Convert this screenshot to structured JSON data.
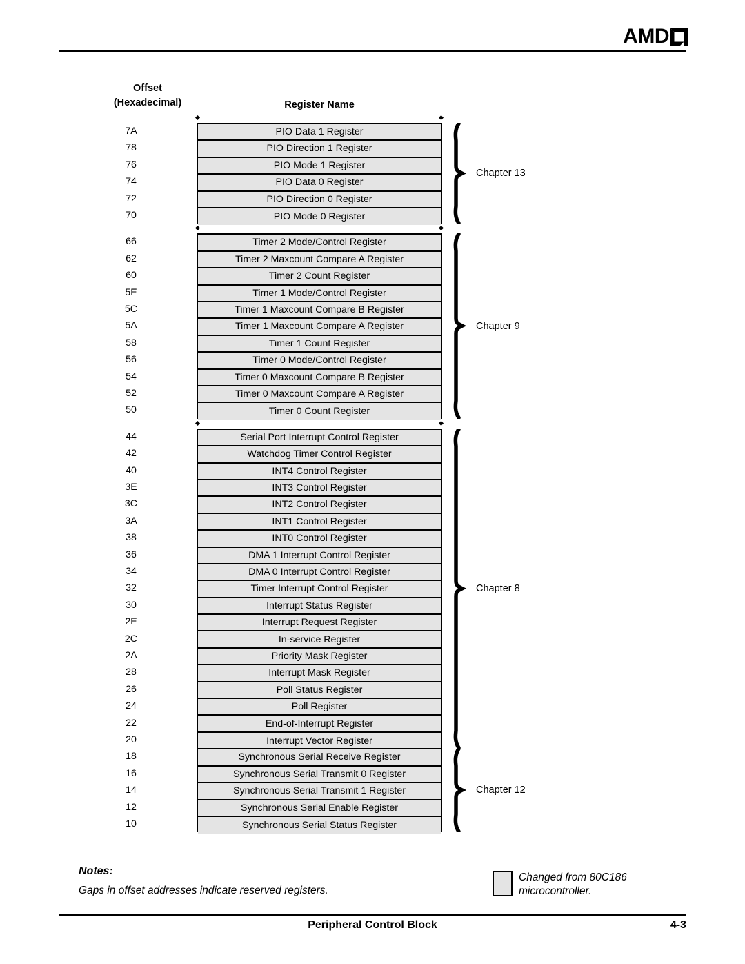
{
  "header": {
    "logo_text": "AMD",
    "logo_mark": "amd-arrow-icon"
  },
  "column_headings": {
    "offset": "Offset\n(Hexadecimal)",
    "offset_line1": "Offset",
    "offset_line2": "(Hexadecimal)",
    "register_name": "Register Name"
  },
  "groups": [
    {
      "chapter": "Chapter 13",
      "rows": [
        {
          "offset": "7A",
          "name": "PIO Data 1 Register"
        },
        {
          "offset": "78",
          "name": "PIO Direction 1 Register"
        },
        {
          "offset": "76",
          "name": "PIO Mode 1 Register"
        },
        {
          "offset": "74",
          "name": "PIO Data 0 Register"
        },
        {
          "offset": "72",
          "name": "PIO Direction 0 Register"
        },
        {
          "offset": "70",
          "name": "PIO Mode 0 Register"
        }
      ]
    },
    {
      "chapter": "Chapter 9",
      "rows": [
        {
          "offset": "66",
          "name": "Timer 2 Mode/Control Register"
        },
        {
          "offset": "62",
          "name": "Timer 2 Maxcount Compare A Register"
        },
        {
          "offset": "60",
          "name": "Timer 2 Count Register"
        },
        {
          "offset": "5E",
          "name": "Timer 1 Mode/Control Register"
        },
        {
          "offset": "5C",
          "name": "Timer 1 Maxcount Compare B Register"
        },
        {
          "offset": "5A",
          "name": "Timer 1 Maxcount Compare A Register"
        },
        {
          "offset": "58",
          "name": "Timer 1 Count Register"
        },
        {
          "offset": "56",
          "name": "Timer 0 Mode/Control Register"
        },
        {
          "offset": "54",
          "name": "Timer 0 Maxcount Compare B Register"
        },
        {
          "offset": "52",
          "name": "Timer 0 Maxcount Compare A Register"
        },
        {
          "offset": "50",
          "name": "Timer 0 Count Register"
        }
      ]
    },
    {
      "chapter": "Chapter 8",
      "rows": [
        {
          "offset": "44",
          "name": "Serial Port Interrupt Control Register"
        },
        {
          "offset": "42",
          "name": "Watchdog Timer Control Register"
        },
        {
          "offset": "40",
          "name": "INT4 Control Register"
        },
        {
          "offset": "3E",
          "name": "INT3 Control Register"
        },
        {
          "offset": "3C",
          "name": "INT2 Control Register"
        },
        {
          "offset": "3A",
          "name": "INT1 Control Register"
        },
        {
          "offset": "38",
          "name": "INT0 Control Register"
        },
        {
          "offset": "36",
          "name": "DMA 1 Interrupt Control Register"
        },
        {
          "offset": "34",
          "name": "DMA 0 Interrupt Control Register"
        },
        {
          "offset": "32",
          "name": "Timer Interrupt Control Register"
        },
        {
          "offset": "30",
          "name": "Interrupt Status Register"
        },
        {
          "offset": "2E",
          "name": "Interrupt Request Register"
        },
        {
          "offset": "2C",
          "name": "In-service Register"
        },
        {
          "offset": "2A",
          "name": "Priority Mask Register"
        },
        {
          "offset": "28",
          "name": "Interrupt Mask Register"
        },
        {
          "offset": "26",
          "name": "Poll Status Register"
        },
        {
          "offset": "24",
          "name": "Poll Register"
        },
        {
          "offset": "22",
          "name": "End-of-Interrupt Register"
        },
        {
          "offset": "20",
          "name": "Interrupt Vector Register"
        }
      ]
    },
    {
      "chapter": "Chapter 12",
      "rows": [
        {
          "offset": "18",
          "name": "Synchronous Serial Receive Register"
        },
        {
          "offset": "16",
          "name": "Synchronous Serial Transmit 0 Register"
        },
        {
          "offset": "14",
          "name": "Synchronous Serial Transmit 1 Register"
        },
        {
          "offset": "12",
          "name": "Synchronous Serial Enable Register"
        },
        {
          "offset": "10",
          "name": "Synchronous Serial Status Register"
        }
      ]
    }
  ],
  "notes": {
    "title": "Notes:",
    "text": "Gaps in offset addresses indicate reserved registers."
  },
  "legend": {
    "text": "Changed from 80C186\nmicrocontroller."
  },
  "footer": {
    "title": "Peripheral Control Block",
    "page": "4-3"
  },
  "colors": {
    "cell_fill": "#e4e4e4",
    "line": "#000000",
    "page_background": "#ffffff"
  }
}
